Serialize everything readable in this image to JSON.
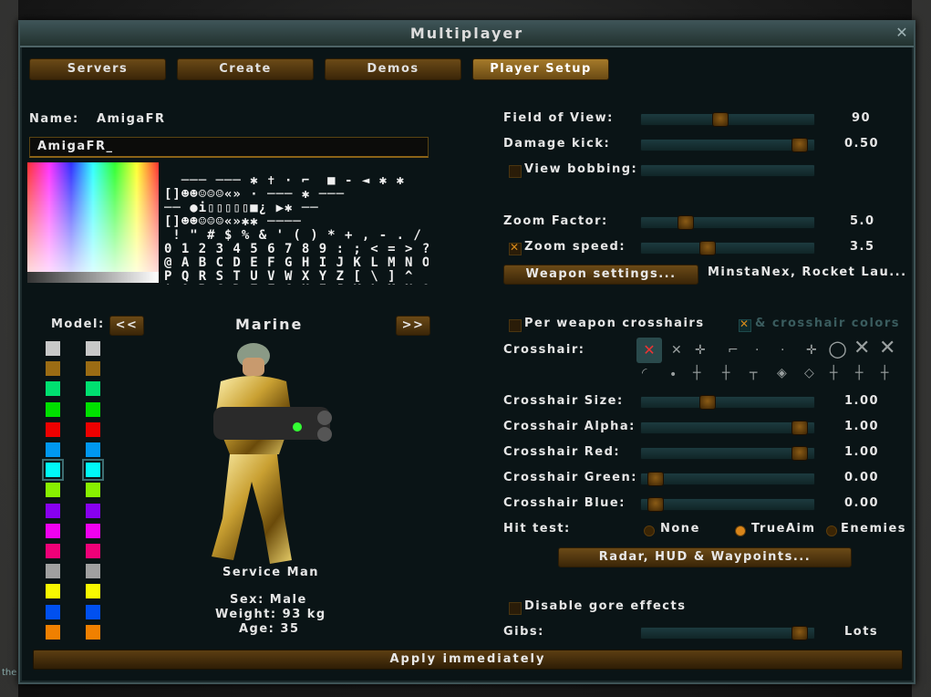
{
  "window": {
    "title": "Multiplayer"
  },
  "tabs": [
    "Servers",
    "Create",
    "Demos",
    "Player Setup"
  ],
  "player": {
    "name_label": "Name:",
    "name_value": "AmigaFR",
    "name_input": "AmigaFR_"
  },
  "model": {
    "label": "Model:",
    "prev": "<<",
    "next": ">>",
    "name": "Marine",
    "description": "Service Man",
    "sex": "Sex: Male",
    "weight": "Weight: 93 kg",
    "age": "Age: 35"
  },
  "colors": {
    "shirt": [
      "#c8c8c8",
      "#9b6c14",
      "#00e070",
      "#00e000",
      "#ee0000",
      "#0098f0",
      "#00f8f8",
      "#88f000",
      "#8800f0",
      "#f000f0",
      "#f00078",
      "#a0a0a0",
      "#f8f800",
      "#0050f0",
      "#f08000"
    ],
    "pants": [
      "#c8c8c8",
      "#9b6c14",
      "#00e070",
      "#00e000",
      "#ee0000",
      "#0098f0",
      "#00f8f8",
      "#88f000",
      "#8800f0",
      "#f000f0",
      "#f00078",
      "#a0a0a0",
      "#f8f800",
      "#0050f0",
      "#f08000"
    ],
    "selected_index": 6
  },
  "settings": {
    "fov": {
      "label": "Field of View:",
      "value": "90",
      "level": 0.45
    },
    "damage_kick": {
      "label": "Damage kick:",
      "value": "0.50",
      "level": 0.95
    },
    "view_bobbing": {
      "label": "View bobbing:",
      "checked": false,
      "level": 0.0
    },
    "zoom_factor": {
      "label": "Zoom Factor:",
      "value": "5.0",
      "level": 0.23
    },
    "zoom_speed": {
      "label": "Zoom speed:",
      "value": "3.5",
      "checked": true,
      "level": 0.37
    },
    "weapon_settings": {
      "label": "Weapon settings...",
      "value": "MinstaNex, Rocket Lau..."
    },
    "per_weapon_crosshairs": {
      "label": "Per weapon crosshairs",
      "checked": false
    },
    "crosshair_colors": {
      "label": "& crosshair colors",
      "checked": true
    },
    "crosshair": {
      "label": "Crosshair:"
    },
    "crosshair_size": {
      "label": "Crosshair Size:",
      "value": "1.00",
      "level": 0.37
    },
    "crosshair_alpha": {
      "label": "Crosshair Alpha:",
      "value": "1.00",
      "level": 0.95
    },
    "crosshair_red": {
      "label": "Crosshair Red:",
      "value": "1.00",
      "level": 0.95
    },
    "crosshair_green": {
      "label": "Crosshair Green:",
      "value": "0.00",
      "level": 0.04
    },
    "crosshair_blue": {
      "label": "Crosshair Blue:",
      "value": "0.00",
      "level": 0.04
    },
    "hit_test": {
      "label": "Hit test:",
      "options": [
        "None",
        "TrueAim",
        "Enemies"
      ],
      "selected": "TrueAim"
    },
    "radar_button": "Radar, HUD & Waypoints...",
    "disable_gore": {
      "label": "Disable gore effects",
      "checked": false
    },
    "gibs": {
      "label": "Gibs:",
      "value": "Lots",
      "level": 0.95
    }
  },
  "apply_button": "Apply immediately",
  "console_hint": "the"
}
